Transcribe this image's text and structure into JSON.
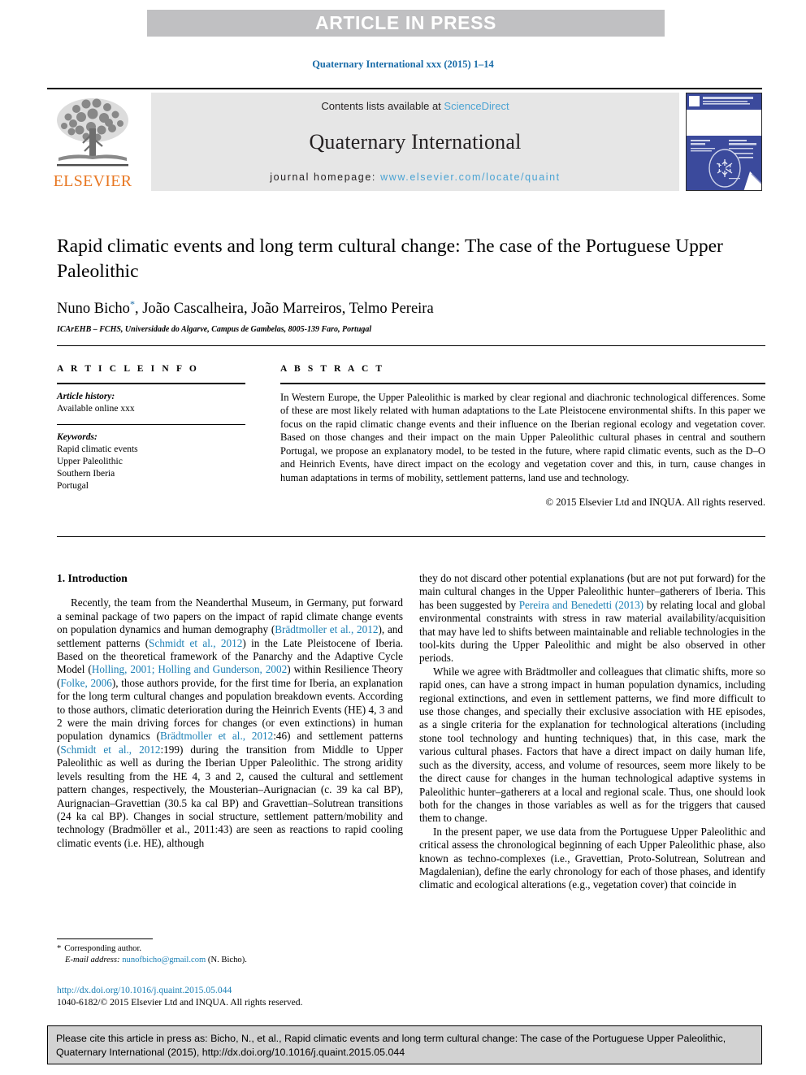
{
  "banner": {
    "text": "ARTICLE IN PRESS"
  },
  "running_head": "Quaternary International xxx (2015) 1–14",
  "masthead": {
    "contents_prefix": "Contents lists available at ",
    "sciencedirect": "ScienceDirect",
    "journal_title": "Quaternary International",
    "homepage_prefix": "journal homepage: ",
    "homepage_url": "www.elsevier.com/locate/quaint",
    "publisher_wordmark": "ELSEVIER",
    "cover_alt": "journal-cover-thumbnail"
  },
  "article": {
    "title": "Rapid climatic events and long term cultural change: The case of the Portuguese Upper Paleolithic",
    "authors": "Nuno Bicho",
    "corresponding_marker": "*",
    "authors_rest": ", João Cascalheira, João Marreiros, Telmo Pereira",
    "affiliation": "ICArEHB – FCHS, Universidade do Algarve, Campus de Gambelas, 8005-139 Faro, Portugal"
  },
  "info": {
    "heading": "A R T I C L E  I N F O",
    "history_label": "Article history:",
    "history_value": "Available online xxx",
    "keywords_label": "Keywords:",
    "keywords": [
      "Rapid climatic events",
      "Upper Paleolithic",
      "Southern Iberia",
      "Portugal"
    ]
  },
  "abstract": {
    "heading": "A B S T R A C T",
    "text": "In Western Europe, the Upper Paleolithic is marked by clear regional and diachronic technological differences. Some of these are most likely related with human adaptations to the Late Pleistocene environmental shifts. In this paper we focus on the rapid climatic change events and their influence on the Iberian regional ecology and vegetation cover. Based on those changes and their impact on the main Upper Paleolithic cultural phases in central and southern Portugal, we propose an explanatory model, to be tested in the future, where rapid climatic events, such as the D–O and Heinrich Events, have direct impact on the ecology and vegetation cover and this, in turn, cause changes in human adaptations in terms of mobility, settlement patterns, land use and technology.",
    "copyright": "© 2015 Elsevier Ltd and INQUA. All rights reserved."
  },
  "body": {
    "section_title": "1. Introduction",
    "left_paragraphs": [
      {
        "segments": [
          {
            "t": "Recently, the team from the Neanderthal Museum, in Germany, put forward a seminal package of two papers on the impact of rapid climate change events on population dynamics and human demography (",
            "ref": false
          },
          {
            "t": "Brädtmoller et al., 2012",
            "ref": true
          },
          {
            "t": "), and settlement patterns (",
            "ref": false
          },
          {
            "t": "Schmidt et al., 2012",
            "ref": true
          },
          {
            "t": ") in the Late Pleistocene of Iberia. Based on the theoretical framework of the Panarchy and the Adaptive Cycle Model (",
            "ref": false
          },
          {
            "t": "Holling, 2001; Holling and Gunderson, 2002",
            "ref": true
          },
          {
            "t": ") within Resilience Theory (",
            "ref": false
          },
          {
            "t": "Folke, 2006",
            "ref": true
          },
          {
            "t": "), those authors provide, for the first time for Iberia, an explanation for the long term cultural changes and population breakdown events. According to those authors, climatic deterioration during the Heinrich Events (HE) 4, 3 and 2 were the main driving forces for changes (or even extinctions) in human population dynamics (",
            "ref": false
          },
          {
            "t": "Brädtmoller et al., 2012",
            "ref": true
          },
          {
            "t": ":46) and settlement patterns (",
            "ref": false
          },
          {
            "t": "Schmidt et al., 2012",
            "ref": true
          },
          {
            "t": ":199) during the transition from Middle to Upper Paleolithic as well as during the Iberian Upper Paleolithic. The strong aridity levels resulting from the HE 4, 3 and 2, caused the cultural and settlement pattern changes, respectively, the Mousterian–Aurignacian (c. 39 ka cal BP), Aurignacian–Gravettian (30.5 ka cal BP) and Gravettian–Solutrean transitions (24 ka cal BP). Changes in social structure, settlement pattern/mobility and technology (Bradmöller et al., 2011:43) are seen as reactions to rapid cooling climatic events (i.e. HE), although",
            "ref": false
          }
        ]
      }
    ],
    "right_paragraphs": [
      {
        "indent": false,
        "segments": [
          {
            "t": "they do not discard other potential explanations (but are not put forward) for the main cultural changes in the Upper Paleolithic hunter–gatherers of Iberia. This has been suggested by ",
            "ref": false
          },
          {
            "t": "Pereira and Benedetti (2013)",
            "ref": true
          },
          {
            "t": " by relating local and global environmental constraints with stress in raw material availability/acquisition that may have led to shifts between maintainable and reliable technologies in the tool-kits during the Upper Paleolithic and might be also observed in other periods.",
            "ref": false
          }
        ]
      },
      {
        "indent": true,
        "segments": [
          {
            "t": "While we agree with Brädtmoller and colleagues that climatic shifts, more so rapid ones, can have a strong impact in human population dynamics, including regional extinctions, and even in settlement patterns, we find more difficult to use those changes, and specially their exclusive association with HE episodes, as a single criteria for the explanation for technological alterations (including stone tool technology and hunting techniques) that, in this case, mark the various cultural phases. Factors that have a direct impact on daily human life, such as the diversity, access, and volume of resources, seem more likely to be the direct cause for changes in the human technological adaptive systems in Paleolithic hunter–gatherers at a local and regional scale. Thus, one should look both for the changes in those variables as well as for the triggers that caused them to change.",
            "ref": false
          }
        ]
      },
      {
        "indent": true,
        "segments": [
          {
            "t": "In the present paper, we use data from the Portuguese Upper Paleolithic and critical assess the chronological beginning of each Upper Paleolithic phase, also known as techno-complexes (i.e., Gravettian, Proto-Solutrean, Solutrean and Magdalenian), define the early chronology for each of those phases, and identify climatic and ecological alterations (e.g., vegetation cover) that coincide in",
            "ref": false
          }
        ]
      }
    ]
  },
  "footnotes": {
    "corresponding_marker": "*",
    "corresponding_text": "Corresponding author.",
    "email_label": "E-mail address:",
    "email": "nunofbicho@gmail.com",
    "email_owner": "(N. Bicho).",
    "doi": "http://dx.doi.org/10.1016/j.quaint.2015.05.044",
    "issn_line": "1040-6182/© 2015 Elsevier Ltd and INQUA. All rights reserved."
  },
  "citation_footer": {
    "text": "Please cite this article in press as: Bicho, N., et al., Rapid climatic events and long term cultural change: The case of the Portuguese Upper Paleolithic, Quaternary International (2015), http://dx.doi.org/10.1016/j.quaint.2015.05.044"
  },
  "colors": {
    "link_blue": "#1a7fb5",
    "light_blue": "#4ba3d3",
    "elsevier_orange": "#e87722",
    "banner_gray": "#c0c0c2",
    "masthead_gray": "#e6e6e6",
    "footer_gray": "#d2d2d2",
    "cover_blue": "#3b4a9c"
  }
}
